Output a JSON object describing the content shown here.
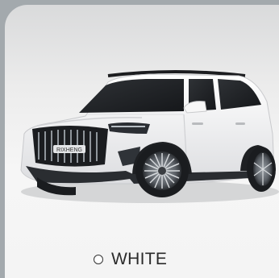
{
  "product": {
    "color_option": {
      "label": "WHITE",
      "swatch_color": "#ffffff",
      "selected": false
    },
    "car_image": {
      "grille_badge": "RIXHENG"
    }
  }
}
